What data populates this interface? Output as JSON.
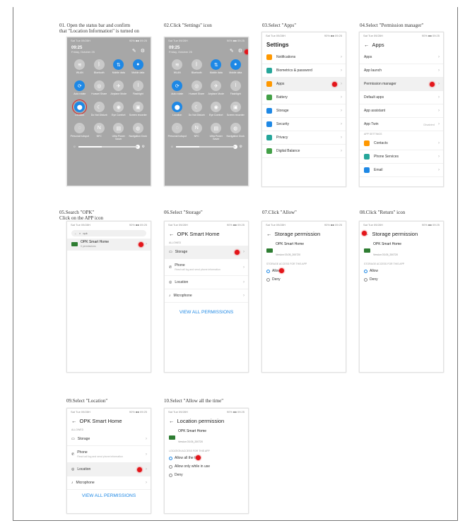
{
  "steps": [
    {
      "caption": "01. Open the status bar and confirm\nthat \"Location Information\" is turned on"
    },
    {
      "caption": "02.Click \"Settings\" icon"
    },
    {
      "caption": "03.Select \"Apps\""
    },
    {
      "caption": "04.Select \"Permission manager\""
    },
    {
      "caption": "05.Search \"OPK\"\nClick on the APP icon"
    },
    {
      "caption": "06.Select \"Storage\""
    },
    {
      "caption": "07.Click \"Allow\""
    },
    {
      "caption": "08.Click \"Return\" icon"
    },
    {
      "caption": "09.Select \"Location\""
    },
    {
      "caption": "10.Select \"Allow all the time\""
    }
  ],
  "status": {
    "left": "Sat Tue 09/28H",
    "right": "90% ■■ 09:25"
  },
  "quick": {
    "time": "09:25",
    "date": "Friday, October 25",
    "tiles": [
      "WLAN",
      "Bluetooth",
      "Mobile data",
      "Mobile data",
      "Auto rotate",
      "Huawei Share",
      "Airplane Mode",
      "Flashlight",
      "Location",
      "Do Not Disturb",
      "Eye Comfort",
      "Screen recorder",
      "Personal hotspot",
      "NFC",
      "Ultra Power Saver",
      "Navigation Dock"
    ]
  },
  "settings": {
    "title": "Settings",
    "items": [
      "Notifications",
      "Biometrics & password",
      "Apps",
      "Battery",
      "Storage",
      "Security",
      "Privacy",
      "Digital Balance"
    ]
  },
  "apps": {
    "title": "Apps",
    "items": [
      "Apps",
      "App launch",
      "Permission manager",
      "Default apps",
      "App assistant",
      "App Twin"
    ],
    "app_twin_extra": "Disabled",
    "section": "APP SETTINGS",
    "sub_items": [
      "Contacts",
      "Phone Services",
      "Email"
    ]
  },
  "search": {
    "query": "opk",
    "app_name": "OPK Smart Home",
    "app_sub": "0 permissions"
  },
  "opk": {
    "title": "OPK Smart Home",
    "section": "ALLOWED",
    "perms": [
      "Storage",
      "Phone",
      "Location",
      "Microphone"
    ],
    "phone_sub": "Read call log and send phone information",
    "view_all": "VIEW ALL PERMISSIONS"
  },
  "storage": {
    "title": "Storage permission",
    "app": "OPK Smart Home",
    "version": "Version 03.05_200720",
    "section": "STORAGE ACCESS FOR THIS APP",
    "options": [
      "Allow",
      "Deny"
    ]
  },
  "location": {
    "title": "Location permission",
    "app": "OPK Smart Home",
    "version": "Version 03.05_200720",
    "section": "LOCATION ACCESS FOR THIS APP",
    "options": [
      "Allow all the time",
      "Allow only while in use",
      "Deny"
    ]
  },
  "colors": {
    "accent": "#1e88e5",
    "marker": "#e3151a"
  }
}
